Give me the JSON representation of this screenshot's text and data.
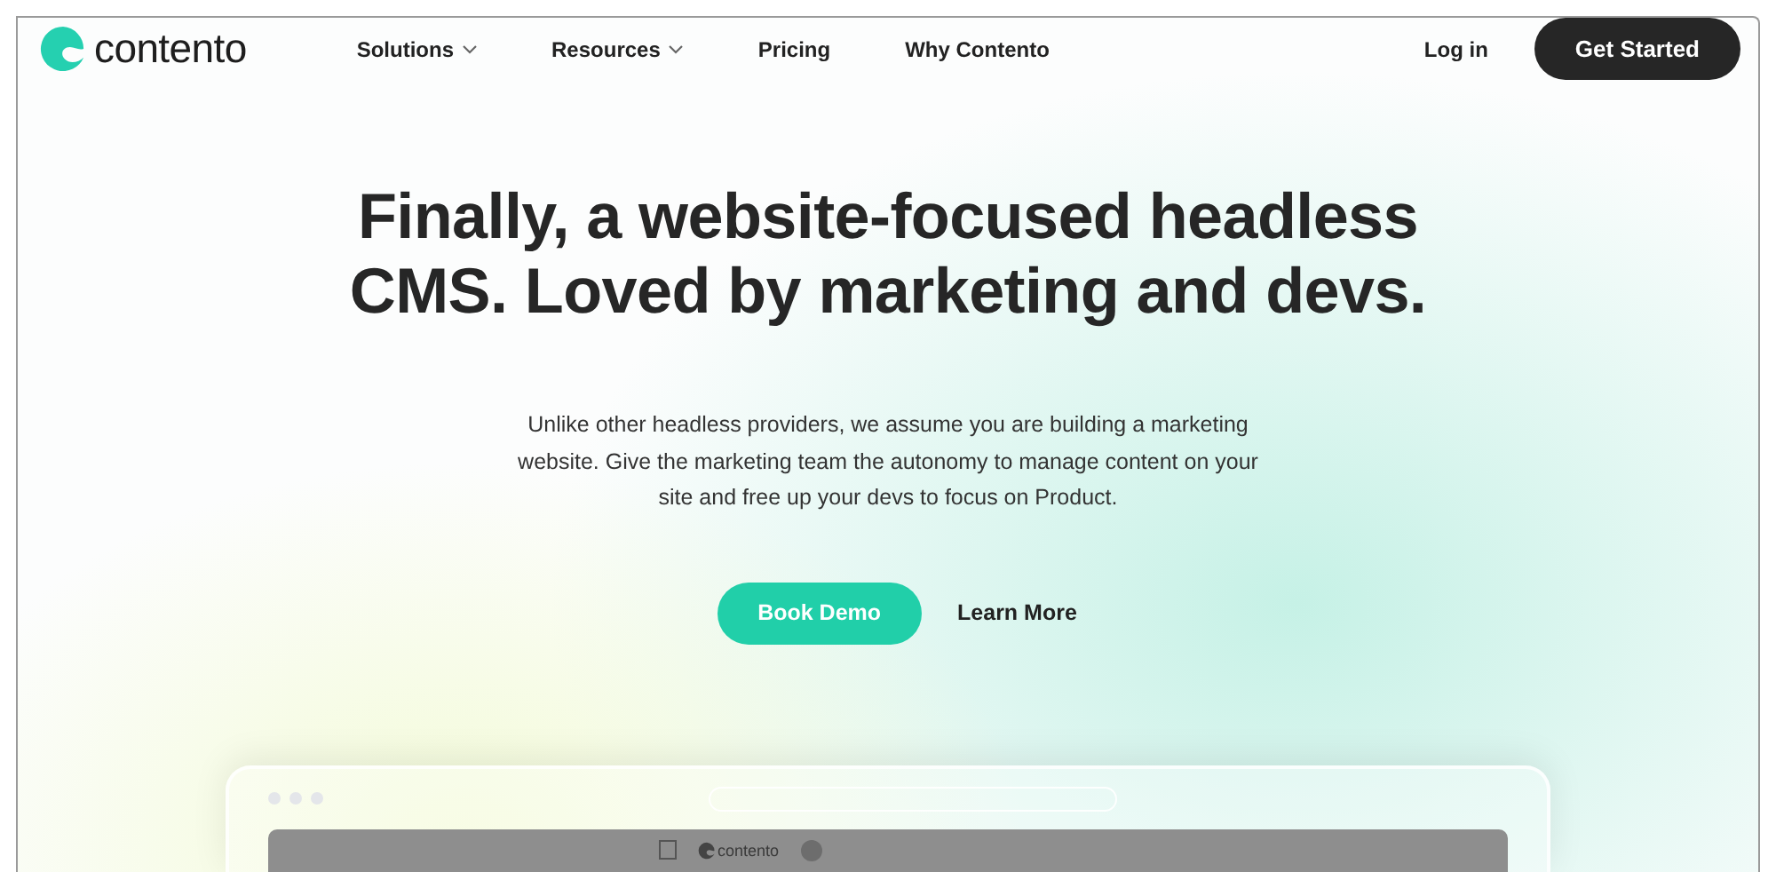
{
  "brand": {
    "name": "contento"
  },
  "nav": {
    "items": [
      {
        "label": "Solutions",
        "dropdown": true
      },
      {
        "label": "Resources",
        "dropdown": true
      },
      {
        "label": "Pricing",
        "dropdown": false
      },
      {
        "label": "Why Contento",
        "dropdown": false
      }
    ],
    "login": "Log in",
    "cta": "Get Started"
  },
  "hero": {
    "title": "Finally, a website-focused headless CMS. Loved by marketing and devs.",
    "body": "Unlike other headless providers, we assume you are building a marketing website. Give the marketing team the autonomy to manage content on your site and free up your devs to focus on Product.",
    "primary": "Book Demo",
    "secondary": "Learn More"
  },
  "preview": {
    "brand": "contento"
  }
}
